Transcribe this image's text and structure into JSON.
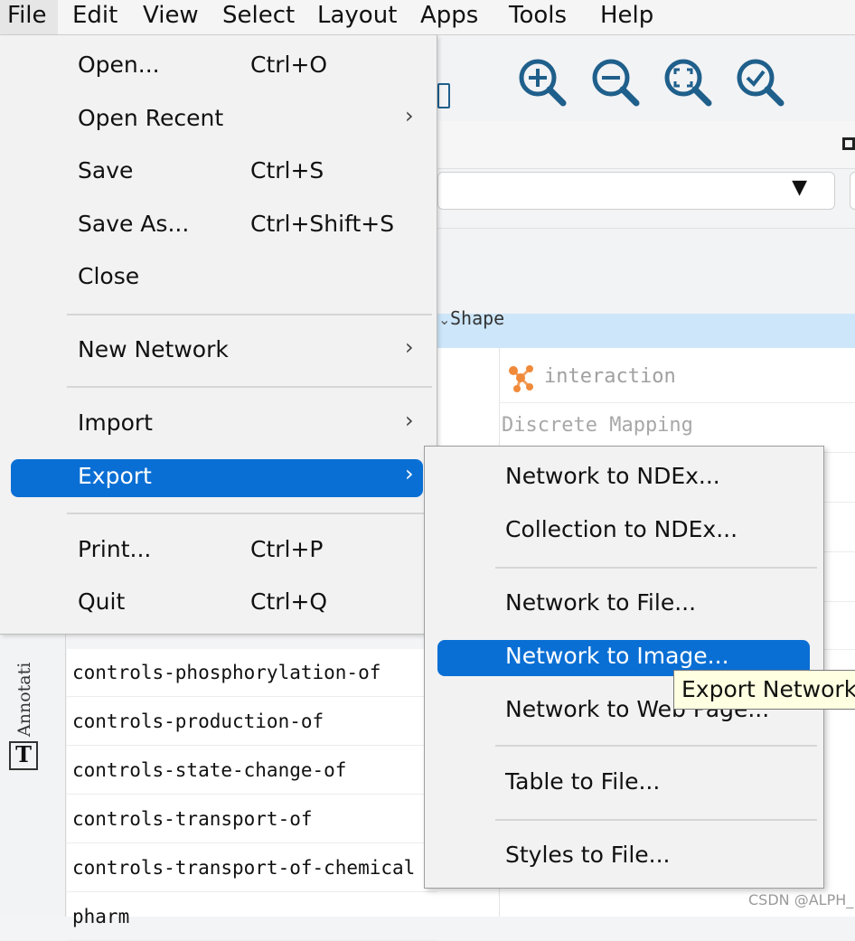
{
  "menubar": {
    "items": [
      "File",
      "Edit",
      "View",
      "Select",
      "Layout",
      "Apps",
      "Tools",
      "Help"
    ]
  },
  "toolbar": {
    "icons": [
      "zoom-in-icon",
      "zoom-out-icon",
      "zoom-fit-icon",
      "zoom-selected-icon"
    ]
  },
  "file_menu": {
    "items": [
      {
        "label": "Open...",
        "shortcut": "Ctrl+O"
      },
      {
        "label": "Open Recent",
        "shortcut": "",
        "submenu": true
      },
      {
        "label": "Save",
        "shortcut": "Ctrl+S"
      },
      {
        "label": "Save As...",
        "shortcut": "Ctrl+Shift+S"
      },
      {
        "label": "Close",
        "shortcut": ""
      },
      {
        "label": "New Network",
        "shortcut": "",
        "submenu": true
      },
      {
        "label": "Import",
        "shortcut": "",
        "submenu": true
      },
      {
        "label": "Export",
        "shortcut": "",
        "submenu": true,
        "active": true
      },
      {
        "label": "Print...",
        "shortcut": "Ctrl+P"
      },
      {
        "label": "Quit",
        "shortcut": "Ctrl+Q"
      }
    ],
    "submenu_arrow": "›"
  },
  "export_menu": {
    "items": [
      {
        "label": "Network to NDEx..."
      },
      {
        "label": "Collection to NDEx..."
      },
      {
        "label": "Network to File..."
      },
      {
        "label": "Network to Image...",
        "active": true
      },
      {
        "label": "Network to Web Page..."
      },
      {
        "label": "Table to File..."
      },
      {
        "label": "Styles to File..."
      }
    ]
  },
  "tooltip": {
    "text": "Export Network"
  },
  "style_panel": {
    "property_label": "Shape",
    "column_value": "interaction",
    "mapping_type": "Discrete Mapping"
  },
  "left_panel": {
    "annotation_tab": "Annotati"
  },
  "table_rows": [
    "controls-phosphorylation-of",
    "controls-production-of",
    "controls-state-change-of",
    "controls-transport-of",
    "controls-transport-of-chemical",
    "pharm"
  ],
  "watermark": "CSDN @ALPH_",
  "colors": {
    "menu_highlight": "#0a6fd4",
    "row_highlight": "#cde6f9",
    "tooltip_bg": "#ffffe1",
    "icon_blue": "#1f5f8b"
  }
}
